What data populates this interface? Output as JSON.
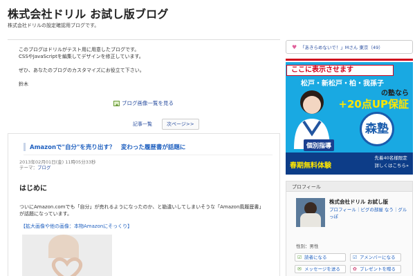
{
  "header": {
    "title": "株式会社ドリル お試し版ブログ",
    "subtitle": "株式会社ドリルの設定確認用ブログです。"
  },
  "intro": {
    "lines": [
      "このブログはドリルがテスト用に用意したブログです。",
      "CSSやJavaScriptを編集してデザインを修正しています。",
      "ぜひ、あなたのブログのカスタマイズにお役立て下さい。",
      "鈴木"
    ]
  },
  "gallery_link": "ブログ画像一覧を見る",
  "pager": {
    "list_label": "記事一覧",
    "next_label": "次ページ>>"
  },
  "entry": {
    "title": "Amazonで\"自分\"を売り出す？　変わった履歴書が話題に",
    "date": "2013年02月01日(金) 11時05分33秒",
    "theme_prefix": "テーマ：",
    "theme": "ブログ",
    "heading": "はじめに",
    "body_line1": "ついにAmazon.comでも「自分」が売れるようになったのか、と勘違いしてしまいそうな「Amazon風履歴書」",
    "body_line2": "が話題になっています。",
    "image_link": "【拡大画像や他の画像：本物Amazonにそっくり】"
  },
  "sidebar": {
    "notice": "「あきらめないで！」Mさん 東京（49）",
    "ad": {
      "placeholder": "ここに表示させます",
      "area": "松戸・新松戸・柏・我孫子",
      "juku": "の塾なら",
      "up": "+20点UP保証",
      "brand": "森塾",
      "kobetsu": "個別指導",
      "free": "春期無料体験",
      "limit_line1": "先着40名様限定",
      "limit_line2": "詳しくはこちら»"
    },
    "profile": {
      "heading": "プロフィール",
      "name": "株式会社ドリル お試し版",
      "links": "プロフィール｜ピグの部屋 なう｜グルっぽ",
      "gender": "性別：男性",
      "buttons": {
        "reader": "読者になる",
        "member": "アメンバーになる",
        "message": "メッセージを送る",
        "present": "プレゼントを贈る"
      }
    }
  }
}
